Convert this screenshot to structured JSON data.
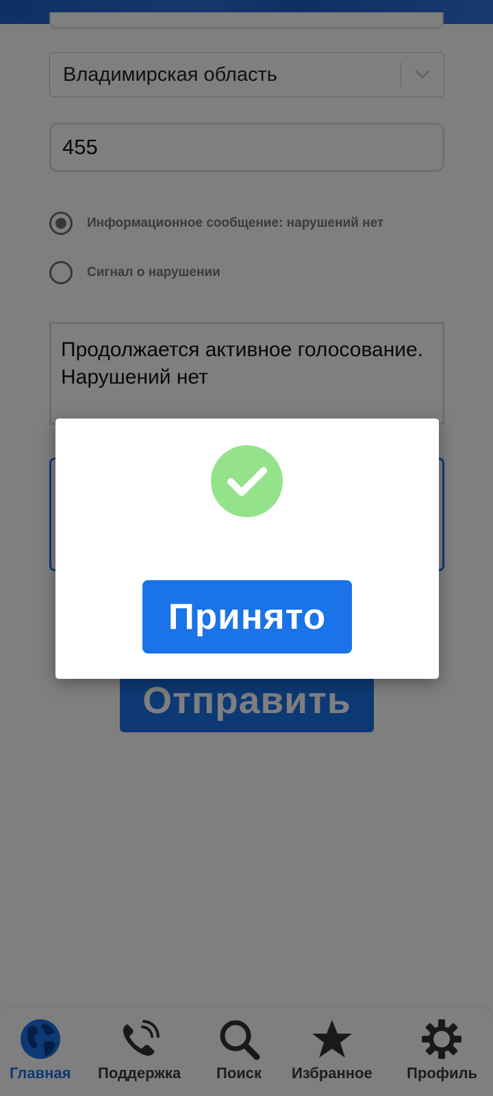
{
  "form": {
    "region_value": "Владимирская область",
    "number_value": "455",
    "radio_options": [
      {
        "label": "Информационное сообщение: нарушений нет",
        "checked": true
      },
      {
        "label": "Сигнал о нарушении",
        "checked": false
      }
    ],
    "comment_text": "Продолжается активное голосование. Нарушений нет",
    "send_label": "Отправить"
  },
  "modal": {
    "status_icon": "success-check-icon",
    "accept_label": "Принято"
  },
  "bottom_nav": {
    "items": [
      {
        "label": "Главная",
        "icon": "globe-icon",
        "active": true
      },
      {
        "label": "Поддержка",
        "icon": "phone-icon",
        "active": false
      },
      {
        "label": "Поиск",
        "icon": "search-icon",
        "active": false
      },
      {
        "label": "Избранное",
        "icon": "star-icon",
        "active": false
      },
      {
        "label": "Профиль",
        "icon": "gear-icon",
        "active": false
      }
    ]
  },
  "colors": {
    "accent": "#1a73e8",
    "success": "#94e38b",
    "overlay": "rgba(0,0,0,0.5)"
  }
}
